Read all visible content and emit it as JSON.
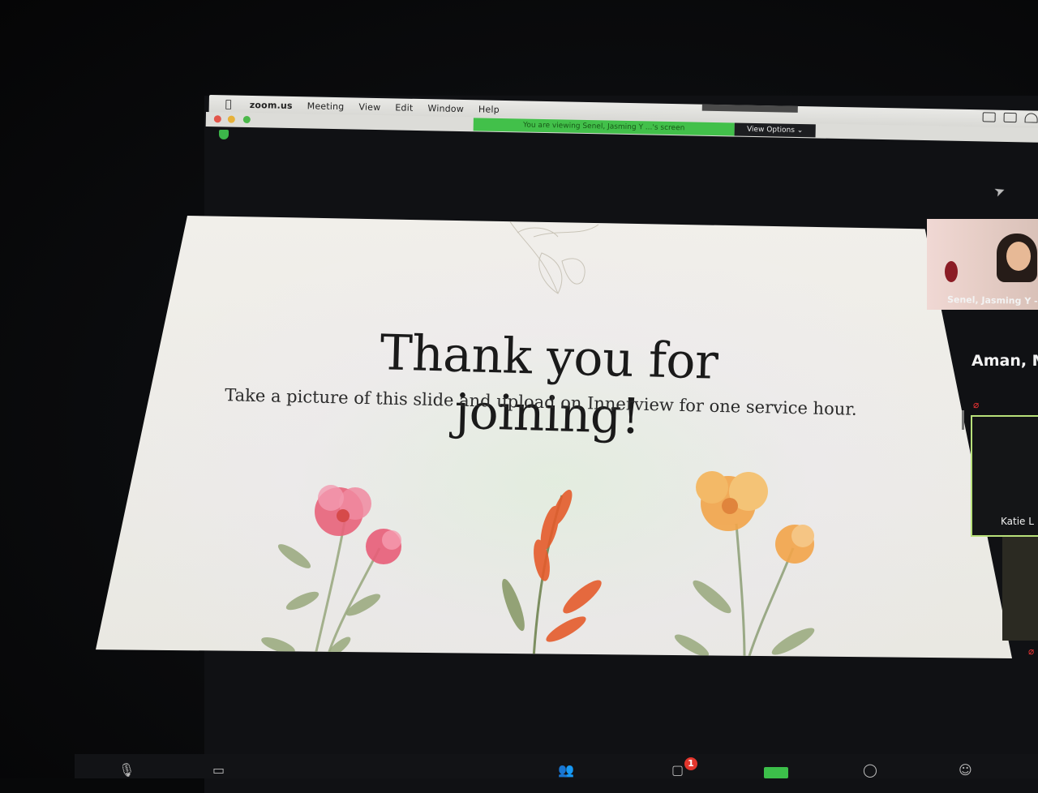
{
  "menubar": {
    "app_name": "zoom.us",
    "items": [
      "Meeting",
      "View",
      "Edit",
      "Window",
      "Help"
    ]
  },
  "share_bar": {
    "banner_text": "You are viewing Senel, Jasming Y ...'s screen",
    "view_options_label": "View Options ⌄"
  },
  "slide": {
    "title": "Thank you for joining!",
    "subtitle": "Take a picture of this slide and upload on Innerview for one service hour."
  },
  "participants": [
    {
      "name": "Senel, Jasming Y -"
    },
    {
      "name": "Aman, M"
    },
    {
      "name": "Katie L"
    }
  ],
  "toolbar": {
    "chat_badge": "1"
  },
  "colors": {
    "share_green": "#42c04a",
    "active_speaker_border": "#b8e07a",
    "badge_red": "#e2362d"
  }
}
